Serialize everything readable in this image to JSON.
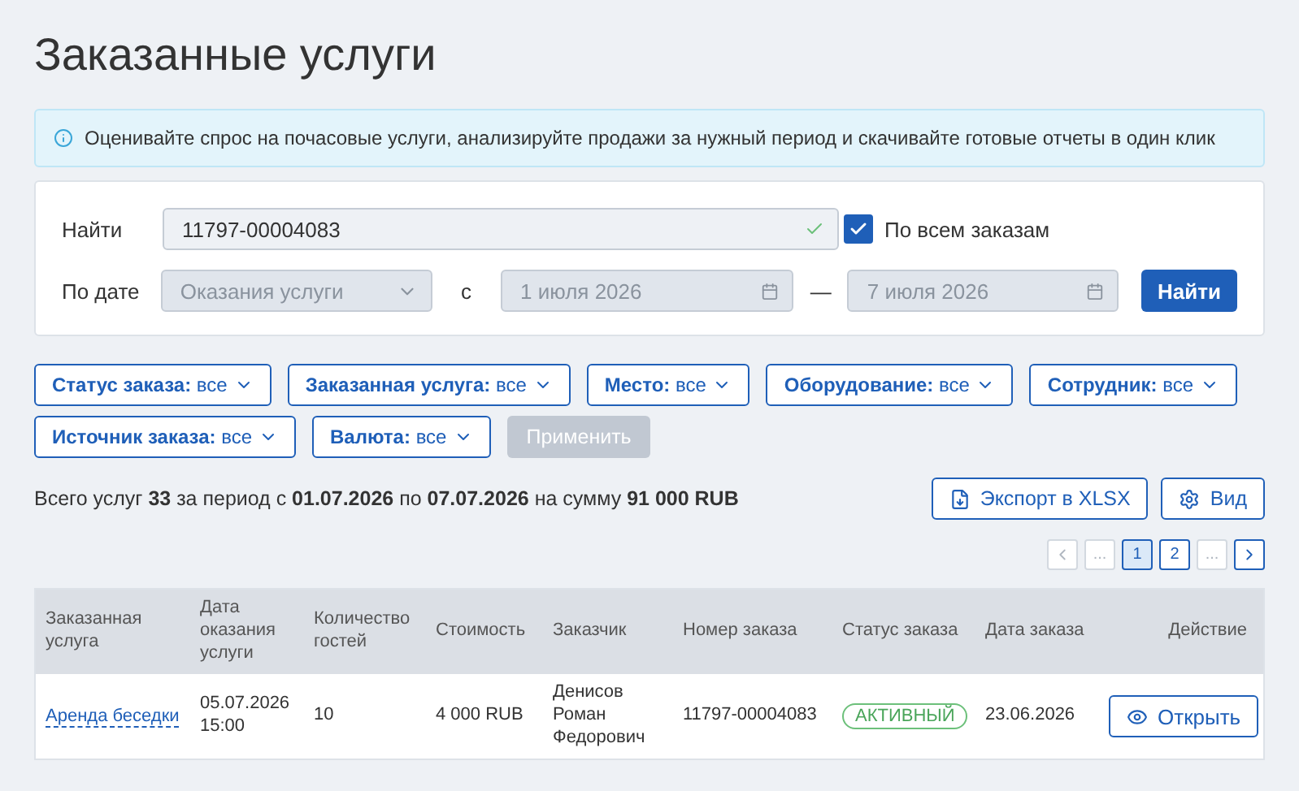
{
  "title": "Заказанные услуги",
  "info": "Оценивайте спрос на почасовые услуги, анализируйте продажи за нужный период и скачивайте готовые отчеты в один клик",
  "search": {
    "label": "Найти",
    "value": "11797-00004083",
    "valid": true,
    "all_orders": {
      "label": "По всем заказам",
      "checked": true
    }
  },
  "date": {
    "label": "По дате",
    "type": "Оказания услуги",
    "from_label": "с",
    "from": "1 июля 2026",
    "dash": "—",
    "to": "7 июля 2026",
    "button": "Найти",
    "disabled": true
  },
  "filters": [
    {
      "label": "**Статус заказа:** все"
    },
    {
      "label": "**Заказанная услуга:** все"
    },
    {
      "label": "**Место:** все"
    },
    {
      "label": "**Оборудование:** все"
    },
    {
      "label": "**Сотрудник:** все"
    },
    {
      "label": "**Источник заказа:** все"
    },
    {
      "label": "**Валюта:** все"
    }
  ],
  "apply": {
    "label": "Применить",
    "disabled": true
  },
  "summary": "Всего услуг **33** за период с **01.07.2026** по **07.07.2026** на сумму **91 000 RUB**",
  "export": "Экспорт в XLSX",
  "view": "Вид",
  "pagination": [
    {
      "kind": "prev",
      "disabled": true
    },
    {
      "kind": "ellipsis",
      "label": "...",
      "disabled": true
    },
    {
      "kind": "page",
      "label": "1",
      "selected": true
    },
    {
      "kind": "page",
      "label": "2",
      "selected": false
    },
    {
      "kind": "ellipsis",
      "label": "...",
      "disabled": true
    },
    {
      "kind": "next",
      "disabled": false
    }
  ],
  "table": {
    "columns": [
      "Заказанная услуга",
      "Дата оказания услуги",
      "Количество гостей",
      "Стоимость",
      "Заказчик",
      "Номер заказа",
      "Статус заказа",
      "Дата заказа",
      "Действие"
    ],
    "rows": [
      {
        "service": "Аренда беседки",
        "date": "05.07.2026 15:00",
        "guests": "10",
        "cost": "4 000 RUB",
        "customer": "Денисов Роман Федорович",
        "order": "11797-00004083",
        "status": "АКТИВНЫЙ",
        "order_date": "23.06.2026",
        "action": "Открыть"
      }
    ]
  }
}
